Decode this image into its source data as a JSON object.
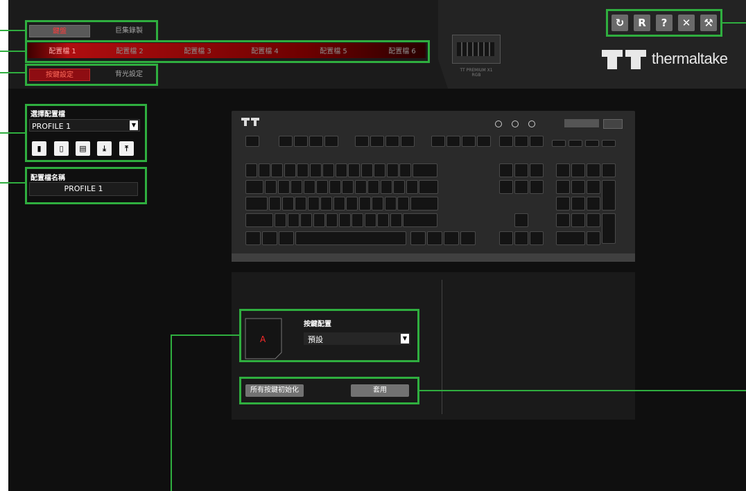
{
  "colors": {
    "accent_green": "#2fae3f",
    "brand_red": "#b00e10"
  },
  "main_tabs": {
    "active": "鍵盤",
    "inactive": "巨集錄製"
  },
  "profile_tabs": [
    "配置檔 1",
    "配置檔 2",
    "配置檔 3",
    "配置檔 4",
    "配置檔 5",
    "配置檔 6"
  ],
  "sub_tabs": {
    "active": "按鍵設定",
    "inactive": "背光設定"
  },
  "device": {
    "name_line1": "TT PREMIUM X1",
    "name_line2": "RGB"
  },
  "brand": {
    "text": "thermaltake"
  },
  "top_icons": [
    "refresh-icon",
    "reset-icon",
    "help-icon",
    "close-icon",
    "settings-icon"
  ],
  "profile_select": {
    "label": "選擇配置檔",
    "value": "PROFILE 1"
  },
  "profile_tools": [
    "document-icon",
    "trash-icon",
    "copy-icon",
    "import-icon",
    "export-icon"
  ],
  "profile_name": {
    "label": "配置檔名稱",
    "value": "PROFILE 1"
  },
  "key_config": {
    "key_label": "A",
    "title": "按鍵配置",
    "value": "預設"
  },
  "actions": {
    "reset_all": "所有按鍵初始化",
    "apply": "套用"
  }
}
